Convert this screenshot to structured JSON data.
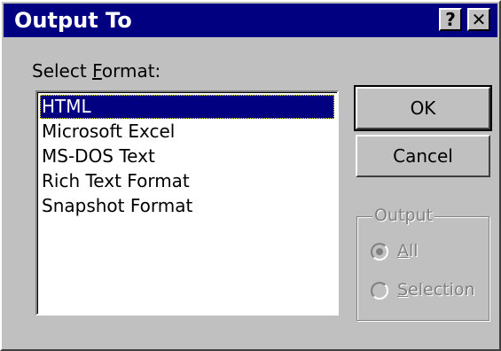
{
  "window": {
    "title": "Output To",
    "help_glyph": "?",
    "close_glyph": "✕"
  },
  "format_label": {
    "prefix": "Select ",
    "mnemonic": "F",
    "suffix": "ormat:"
  },
  "formats": {
    "selected_index": 0,
    "items": [
      "HTML",
      "Microsoft Excel",
      "MS-DOS Text",
      "Rich Text Format",
      "Snapshot Format"
    ]
  },
  "buttons": {
    "ok": "OK",
    "cancel": "Cancel"
  },
  "output_group": {
    "legend": "Output",
    "all_mnemonic": "A",
    "all_rest": "ll",
    "selection_mnemonic": "S",
    "selection_rest": "election",
    "selected": "All",
    "enabled": false
  },
  "colors": {
    "face": "#c0c0c0",
    "titlebar": "#000080",
    "selection": "#000080",
    "disabled_text": "#808080"
  }
}
